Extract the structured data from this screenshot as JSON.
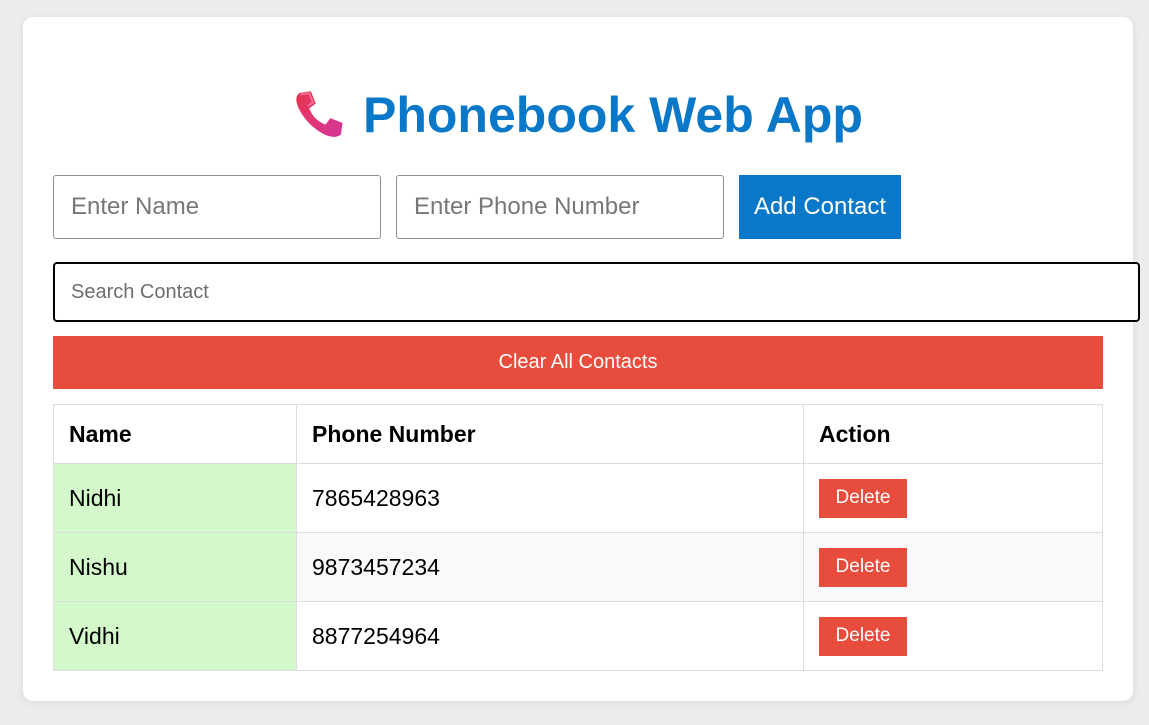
{
  "app": {
    "title": "Phonebook Web App",
    "icon": "telephone-receiver-icon",
    "accent_color": "#0a78c8",
    "danger_color": "#e74c3c",
    "highlight_color": "#d3f8c9"
  },
  "form": {
    "name_value": "",
    "name_placeholder": "Enter Name",
    "phone_value": "",
    "phone_placeholder": "Enter Phone Number",
    "add_label": "Add Contact"
  },
  "search": {
    "value": "",
    "placeholder": "Search Contact"
  },
  "clear_label": "Clear All Contacts",
  "table": {
    "headers": [
      "Name",
      "Phone Number",
      "Action"
    ],
    "rows": [
      {
        "name": "Nidhi",
        "phone": "7865428963",
        "action": "Delete"
      },
      {
        "name": "Nishu",
        "phone": "9873457234",
        "action": "Delete"
      },
      {
        "name": "Vidhi",
        "phone": "8877254964",
        "action": "Delete"
      }
    ]
  }
}
